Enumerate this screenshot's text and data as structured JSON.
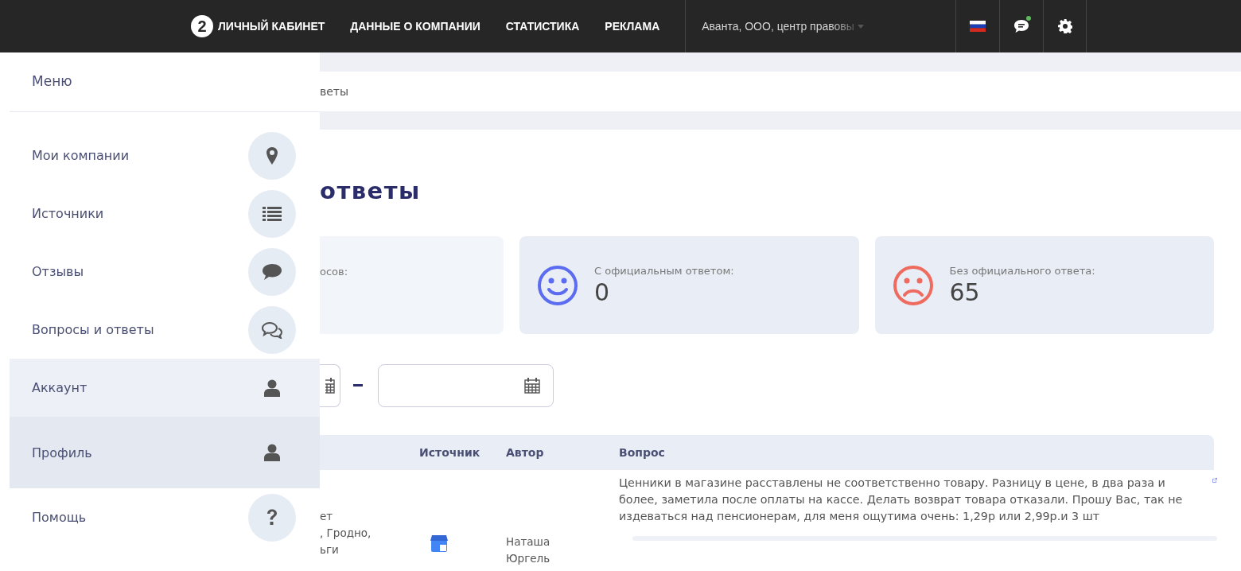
{
  "header": {
    "logo": "2",
    "nav": [
      {
        "label": "ЛИЧНЫЙ КАБИНЕТ"
      },
      {
        "label": "ДАННЫЕ О КОМПАНИИ"
      },
      {
        "label": "СТАТИСТИКА"
      },
      {
        "label": "РЕКЛАМА"
      }
    ],
    "company_select": {
      "value": "Аванта, ООО, центр правовы"
    },
    "chat_unread": true
  },
  "sidebar": {
    "title": "Меню",
    "items": [
      {
        "label": "Мои компании",
        "selected": false,
        "hovered": false
      },
      {
        "label": "Источники",
        "selected": false,
        "hovered": false
      },
      {
        "label": "Отзывы",
        "selected": false,
        "hovered": false
      },
      {
        "label": "Вопросы и ответы",
        "selected": false,
        "hovered": false
      },
      {
        "label": "Аккаунт",
        "selected": false,
        "hovered": true
      },
      {
        "label": "Профиль",
        "selected": true,
        "hovered": false
      },
      {
        "label": "Помощь",
        "selected": false,
        "hovered": false
      }
    ]
  },
  "breadcrumb": "веты",
  "page_title": "ответы",
  "stats": [
    {
      "kind": "partial",
      "label": "осов:"
    },
    {
      "kind": "positive",
      "label": "С официальным ответом:",
      "value": "0"
    },
    {
      "kind": "negative",
      "label": "Без официального ответа:",
      "value": "65"
    }
  ],
  "table": {
    "columns": [
      "",
      "Источник",
      "Автор",
      "Вопрос"
    ],
    "rows": [
      {
        "column_1": [
          "ет",
          ", Гродно,",
          "ьги"
        ],
        "author": "Наташа Юргель",
        "question": "Ценники в магазине расставлены не соответственно товару. Разницу в цене, в два раза и более, заметила после оплаты на кассе. Делать возврат товара отказали. Прошу Вас, так не издеваться над пенсионерам, для меня ощутима очень: 1,29р или 2,99р.и 3 шт"
      }
    ]
  }
}
